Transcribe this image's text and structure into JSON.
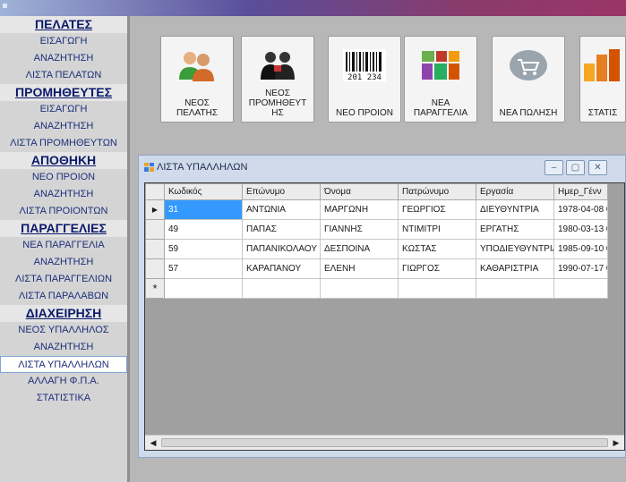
{
  "sidebar": {
    "sections": [
      {
        "title": "ΠΕΛΑΤΕΣ",
        "items": [
          "ΕΙΣΑΓΩΓΗ",
          "ΑΝΑΖΗΤΗΣΗ",
          "ΛΙΣΤΑ ΠΕΛΑΤΩΝ"
        ]
      },
      {
        "title": "ΠΡΟΜΗΘΕΥΤΕΣ",
        "items": [
          "ΕΙΣΑΓΩΓΗ",
          "ΑΝΑΖΗΤΗΣΗ",
          "ΛΙΣΤΑ ΠΡΟΜΗΘΕΥΤΩΝ"
        ]
      },
      {
        "title": "ΑΠΟΘΗΚΗ",
        "items": [
          "ΝΕΟ ΠΡΟΙΟΝ",
          "ΑΝΑΖΗΤΗΣΗ",
          "ΛΙΣΤΑ ΠΡΟΙΟΝΤΩΝ"
        ]
      },
      {
        "title": "ΠΑΡΑΓΓΕΛΙΕΣ",
        "items": [
          "ΝΕΑ ΠΑΡΑΓΓΕΛΙΑ",
          "ΑΝΑΖΗΤΗΣΗ",
          "ΛΙΣΤΑ ΠΑΡΑΓΓΕΛΙΩΝ",
          "ΛΙΣΤΑ ΠΑΡΑΛΑΒΩΝ"
        ]
      },
      {
        "title": "ΔΙΑΧΕΙΡΗΣΗ",
        "items": [
          "ΝΕΟΣ ΥΠΑΛΛΗΛΟΣ",
          "ΑΝΑΖΗΤΗΣΗ",
          "ΛΙΣΤΑ ΥΠΑΛΛΗΛΩΝ",
          "ΑΛΛΑΓΗ Φ.Π.Α.",
          "ΣΤΑΤΙΣΤΙΚΑ"
        ]
      }
    ]
  },
  "toolbar": {
    "buttons": [
      {
        "label": "ΝΕΟΣ\nΠΕΛΑΤΗΣ",
        "icon": "users-icon"
      },
      {
        "label": "ΝΕΟΣ\nΠΡΟΜΗΘΕΥΤ\nΗΣ",
        "icon": "supplier-icon"
      },
      {
        "label": "ΝΕΟ ΠΡΟΙΟΝ",
        "icon": "barcode-icon"
      },
      {
        "label": "ΝΕΑ\nΠΑΡΑΓΓΕΛΙΑ",
        "icon": "products-icon"
      },
      {
        "label": "ΝΕΑ ΠΩΛΗΣΗ",
        "icon": "cart-icon"
      },
      {
        "label": "ΣΤΑΤΙΣ",
        "icon": "bar-chart-icon"
      }
    ]
  },
  "window": {
    "title": "ΛΙΣΤΑ ΥΠΑΛΛΗΛΩΝ",
    "columns": [
      "Κωδικός",
      "Επώνυμο",
      "Όνομα",
      "Πατρώνυμο",
      "Εργασία",
      "Ημερ_Γένν"
    ],
    "rows": [
      [
        "31",
        "ΑΝΤΩΝΙΑ",
        "ΜΑΡΓΩΝΗ",
        "ΓΕΩΡΓΙΟΣ",
        "ΔΙΕΥΘΥΝΤΡΙΑ",
        "1978-04-08 0"
      ],
      [
        "49",
        "ΠΑΠΑΣ",
        "ΓΙΑΝΝΗΣ",
        "ΝΤΙΜΙΤΡΙ",
        "ΕΡΓΑΤΗΣ",
        "1980-03-13 0"
      ],
      [
        "59",
        "ΠΑΠΑΝΙΚΟΛΑΟΥ",
        "ΔΕΣΠΟΙΝΑ",
        "ΚΩΣΤΑΣ",
        "ΥΠΟΔΙΕΥΘΥΝΤΡΙΑ",
        "1985-09-10 0"
      ],
      [
        "57",
        "ΚΑΡΑΠΑΝΟΥ",
        "ΕΛΕΝΗ",
        "ΓΙΩΡΓΟΣ",
        "ΚΑΘΑΡΙΣΤΡΙΑ",
        "1990-07-17 0"
      ]
    ],
    "new_row_marker": "*",
    "current_row_marker": "▶"
  }
}
